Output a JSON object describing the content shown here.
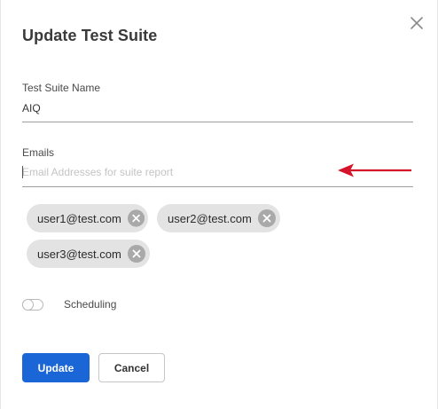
{
  "dialog": {
    "title": "Update Test Suite"
  },
  "suite_name": {
    "label": "Test Suite Name",
    "value": "AIQ"
  },
  "emails": {
    "label": "Emails",
    "placeholder": "Email Addresses for suite report",
    "chips": [
      {
        "label": "user1@test.com"
      },
      {
        "label": "user2@test.com"
      },
      {
        "label": "user3@test.com"
      }
    ]
  },
  "scheduling": {
    "label": "Scheduling",
    "enabled": false
  },
  "actions": {
    "update_label": "Update",
    "cancel_label": "Cancel"
  },
  "colors": {
    "primary": "#1a66d6",
    "arrow": "#d3142a",
    "chip_bg": "#e3e3e3"
  },
  "icons": {
    "close": "close-icon",
    "chip_remove": "cancel-circle-icon",
    "arrow": "left-arrow-icon"
  }
}
